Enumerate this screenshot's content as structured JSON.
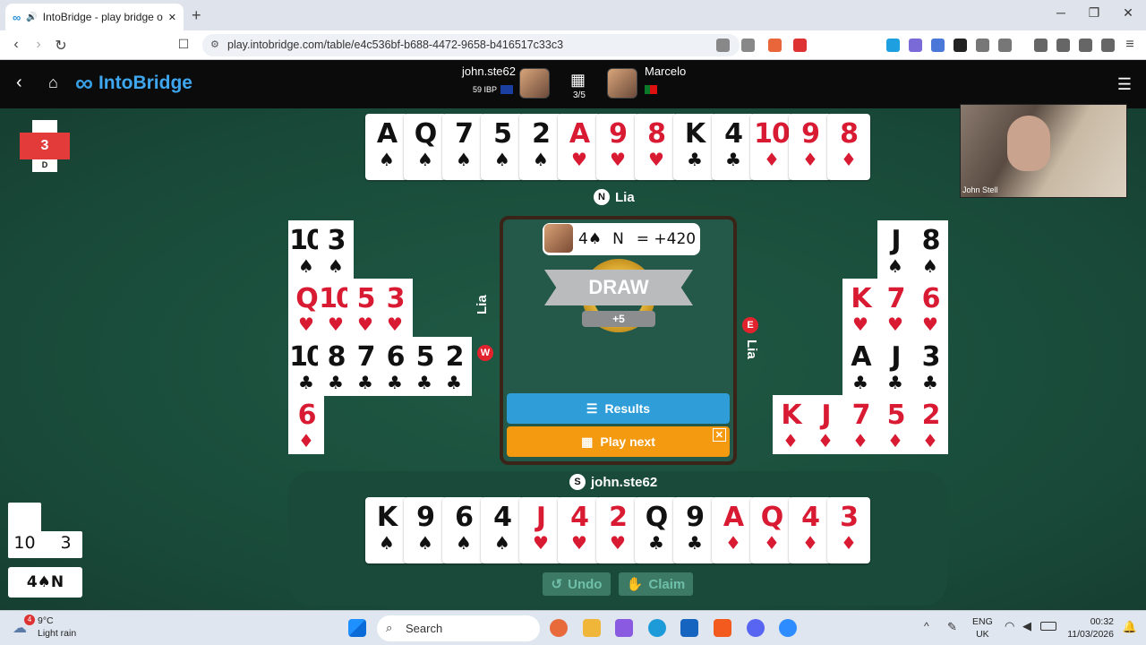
{
  "browser": {
    "tab_title": "IntoBridge - play bridge onlin",
    "url": "play.intobridge.com/table/e4c536bf-b688-4472-9658-b416517c33c3",
    "win_min": "─",
    "win_max": "❐",
    "win_close": "✕",
    "new_tab": "+",
    "tab_close": "✕",
    "audio": "🔊"
  },
  "app": {
    "brand": "IntoBridge",
    "board_progress": "3/5",
    "north_player": "john.ste62",
    "north_rating": "59 IBP",
    "opponent": "Marcelo"
  },
  "vulnerability": {
    "board": "3",
    "dealer": "D"
  },
  "hands": {
    "north": {
      "seat": "N",
      "name": "Lia",
      "cards": [
        {
          "r": "A",
          "s": "♠",
          "c": "blk"
        },
        {
          "r": "Q",
          "s": "♠",
          "c": "blk"
        },
        {
          "r": "7",
          "s": "♠",
          "c": "blk"
        },
        {
          "r": "5",
          "s": "♠",
          "c": "blk"
        },
        {
          "r": "2",
          "s": "♠",
          "c": "blk"
        },
        {
          "r": "A",
          "s": "♥",
          "c": "red"
        },
        {
          "r": "9",
          "s": "♥",
          "c": "red"
        },
        {
          "r": "8",
          "s": "♥",
          "c": "red"
        },
        {
          "r": "K",
          "s": "♣",
          "c": "blk"
        },
        {
          "r": "4",
          "s": "♣",
          "c": "blk"
        },
        {
          "r": "10",
          "s": "♦",
          "c": "red"
        },
        {
          "r": "9",
          "s": "♦",
          "c": "red"
        },
        {
          "r": "8",
          "s": "♦",
          "c": "red"
        }
      ]
    },
    "south": {
      "seat": "S",
      "name": "john.ste62",
      "cards": [
        {
          "r": "K",
          "s": "♠",
          "c": "blk"
        },
        {
          "r": "9",
          "s": "♠",
          "c": "blk"
        },
        {
          "r": "6",
          "s": "♠",
          "c": "blk"
        },
        {
          "r": "4",
          "s": "♠",
          "c": "blk"
        },
        {
          "r": "J",
          "s": "♥",
          "c": "red"
        },
        {
          "r": "4",
          "s": "♥",
          "c": "red"
        },
        {
          "r": "2",
          "s": "♥",
          "c": "red"
        },
        {
          "r": "Q",
          "s": "♣",
          "c": "blk"
        },
        {
          "r": "9",
          "s": "♣",
          "c": "blk"
        },
        {
          "r": "A",
          "s": "♦",
          "c": "red"
        },
        {
          "r": "Q",
          "s": "♦",
          "c": "red"
        },
        {
          "r": "4",
          "s": "♦",
          "c": "red"
        },
        {
          "r": "3",
          "s": "♦",
          "c": "red"
        }
      ]
    },
    "west": {
      "seat": "W",
      "name": "Lia",
      "rows": [
        [
          {
            "r": "10",
            "s": "♠",
            "c": "blk"
          },
          {
            "r": "3",
            "s": "♠",
            "c": "blk"
          }
        ],
        [
          {
            "r": "Q",
            "s": "♥",
            "c": "red"
          },
          {
            "r": "10",
            "s": "♥",
            "c": "red"
          },
          {
            "r": "5",
            "s": "♥",
            "c": "red"
          },
          {
            "r": "3",
            "s": "♥",
            "c": "red"
          }
        ],
        [
          {
            "r": "10",
            "s": "♣",
            "c": "blk"
          },
          {
            "r": "8",
            "s": "♣",
            "c": "blk"
          },
          {
            "r": "7",
            "s": "♣",
            "c": "blk"
          },
          {
            "r": "6",
            "s": "♣",
            "c": "blk"
          },
          {
            "r": "5",
            "s": "♣",
            "c": "blk"
          },
          {
            "r": "2",
            "s": "♣",
            "c": "blk"
          }
        ],
        [
          {
            "r": "6",
            "s": "♦",
            "c": "red"
          }
        ]
      ]
    },
    "east": {
      "seat": "E",
      "name": "Lia",
      "rows": [
        [
          {
            "r": "J",
            "s": "♠",
            "c": "blk"
          },
          {
            "r": "8",
            "s": "♠",
            "c": "blk"
          }
        ],
        [
          {
            "r": "K",
            "s": "♥",
            "c": "red"
          },
          {
            "r": "7",
            "s": "♥",
            "c": "red"
          },
          {
            "r": "6",
            "s": "♥",
            "c": "red"
          }
        ],
        [
          {
            "r": "A",
            "s": "♣",
            "c": "blk"
          },
          {
            "r": "J",
            "s": "♣",
            "c": "blk"
          },
          {
            "r": "3",
            "s": "♣",
            "c": "blk"
          }
        ],
        [
          {
            "r": "K",
            "s": "♦",
            "c": "red"
          },
          {
            "r": "J",
            "s": "♦",
            "c": "red"
          },
          {
            "r": "7",
            "s": "♦",
            "c": "red"
          },
          {
            "r": "5",
            "s": "♦",
            "c": "red"
          },
          {
            "r": "2",
            "s": "♦",
            "c": "red"
          }
        ]
      ]
    }
  },
  "result": {
    "contract_level": "4♠",
    "declarer": "N",
    "score": "= +420",
    "outcome": "DRAW",
    "points": "+5",
    "results_label": "Results",
    "play_next_label": "Play next"
  },
  "actions": {
    "undo": "Undo",
    "claim": "Claim"
  },
  "tricks": {
    "ns": "10",
    "ew": "3"
  },
  "contract_box": "4♠N",
  "video": {
    "name": "John Stell"
  },
  "taskbar": {
    "weather_badge": "4",
    "temp": "9°C",
    "weather": "Light rain",
    "search": "Search",
    "lang1": "ENG",
    "lang2": "UK",
    "time": "00:32",
    "date": "11/03/2026"
  },
  "colors": {
    "felt": "#1f5a45",
    "accent": "#3ea7ef",
    "red_suit": "#d81b32",
    "results": "#2f9ed8",
    "play_next": "#f39a10"
  }
}
